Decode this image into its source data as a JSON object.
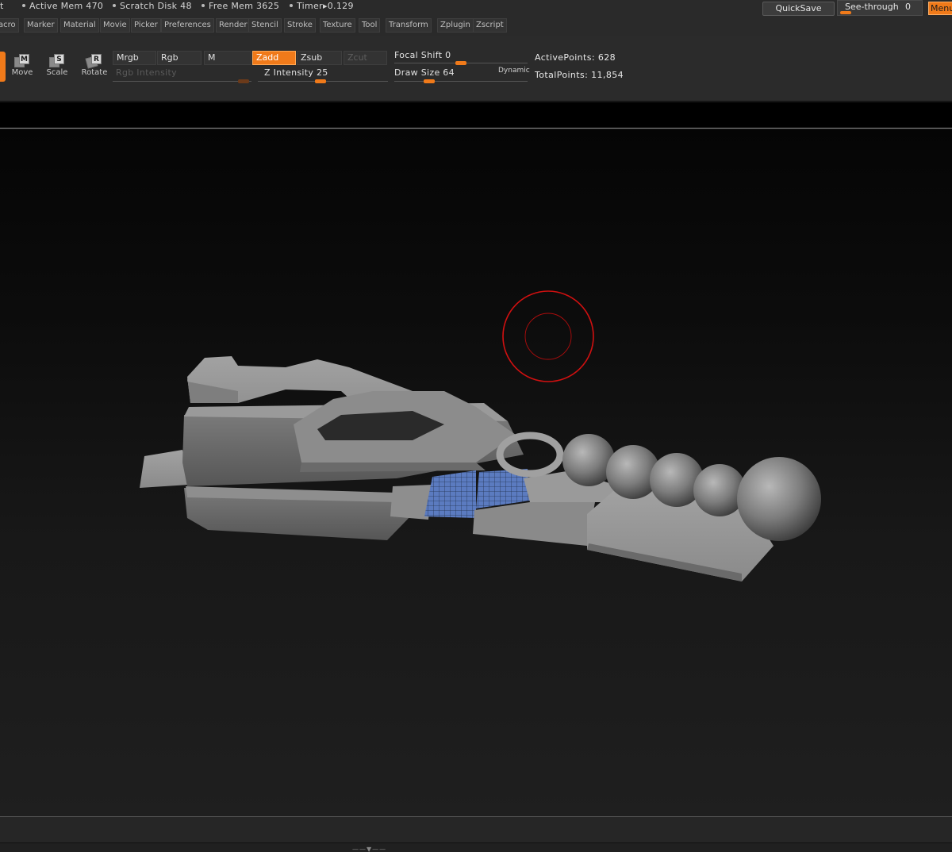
{
  "status": {
    "left_fragment": "t",
    "active_mem": "Active Mem 470",
    "scratch_disk": "Scratch Disk 48",
    "free_mem": "Free Mem 3625",
    "timer": "Timer▸0.129",
    "quicksave": "QuickSave",
    "see_through_label": "See-through",
    "see_through_value": "0",
    "menus": "Menus"
  },
  "menu": [
    "acro",
    "Marker",
    "Material",
    "Movie",
    "Picker",
    "Preferences",
    "Render",
    "Stencil",
    "Stroke",
    "Texture",
    "Tool",
    "Transform",
    "Zplugin",
    "Zscript"
  ],
  "transform_tools": [
    {
      "key": "M",
      "label": "Move"
    },
    {
      "key": "S",
      "label": "Scale"
    },
    {
      "key": "R",
      "label": "Rotate"
    }
  ],
  "shelf": {
    "mrgb": "Mrgb",
    "rgb": "Rgb",
    "m": "M",
    "zadd": "Zadd",
    "zsub": "Zsub",
    "zcut": "Zcut",
    "rgb_intensity": "Rgb Intensity",
    "z_intensity": "Z Intensity 25",
    "focal_shift": "Focal Shift 0",
    "draw_size": "Draw Size 64",
    "dynamic": "Dynamic",
    "active_points": "ActivePoints: 628",
    "total_points": "TotalPoints: 11,854"
  },
  "sliders": {
    "rgb_intensity_fraction": 1.0,
    "z_intensity": 25,
    "focal_shift": 0,
    "draw_size": 64,
    "see_through": 0
  },
  "colors": {
    "accent": "#f07a1a",
    "brush_cursor": "#d01010",
    "mesh_grey": "#8a8a8a",
    "masked_poly": "#5a78b8"
  },
  "bottom": {
    "grip": "——▼——"
  }
}
